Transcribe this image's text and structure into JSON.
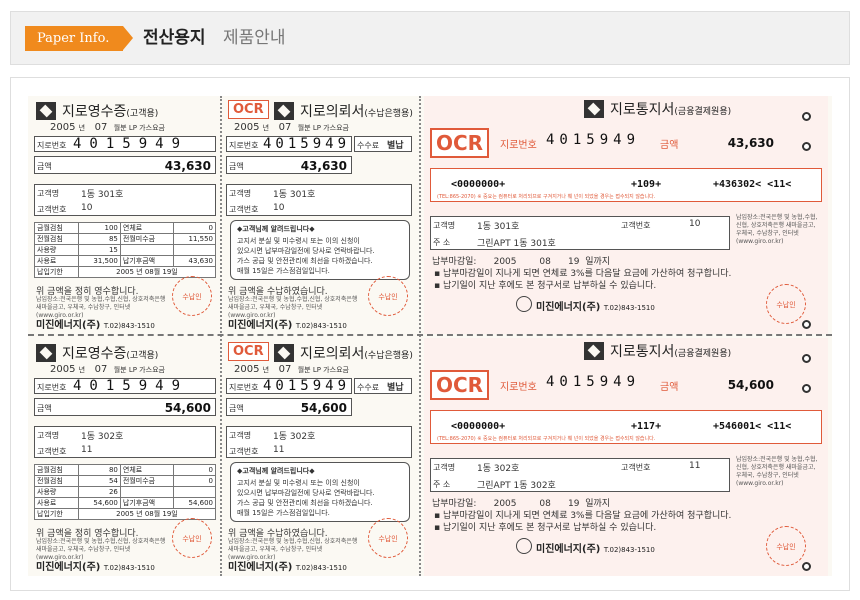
{
  "header": {
    "badge": "Paper Info.",
    "title_main": "전산용지",
    "title_sub": "제품안내"
  },
  "common": {
    "receipt_title": "지로영수증",
    "receipt_sub": "(고객용)",
    "confirm_title": "지로의뢰서",
    "confirm_sub": "(수납은행용)",
    "notice_title": "지로통지서",
    "notice_sub": "(금융결제원용)",
    "ocr": "OCR",
    "year": "2005",
    "year_unit": "년",
    "month": "07",
    "period_text": "월분 LP 가스요금",
    "giro_label": "지로번호",
    "giro_number": "4015949",
    "amount_label": "금액",
    "customer_label": "고객명",
    "cust_no_label": "고객번호",
    "fee_label": "수수료",
    "separate": "별납",
    "stamp": "수납인",
    "company": "미진에너지(주)",
    "phone": "T.02)843-1510",
    "address_label": "주 소",
    "due_label": "납부마감일:",
    "due_year": "2005",
    "due_month": "08",
    "due_day": "19",
    "due_suffix": "일까지",
    "notice_line1": "납부마감일이 지나게 되면 연체료 3%를 다음달 요금에 가산하여 청구합니다.",
    "notice_line2": "납기일이 지난 후에도 본 청구서로 납부하실 수 있습니다.",
    "receipt_confirm": "위 금액을 정히 영수합니다.",
    "confirm_paid": "위 금액을 수납하였습니다.",
    "guide_title": "◆고객님께 알려드립니다◆",
    "guide_lines": [
      "고지서 분실 및 미수령시 또는 이의 신청이",
      "있으시면 납부마감일전에 당사로 연락바랍니다.",
      "가스 공급 및 안전관리에 최선을 다하겠습니다.",
      "매월 15일은 가스점검일입니다."
    ],
    "banks_note": "납입장소:전국은행 및 농협,수협,신협, 상호저축은행 새마을금고, 우체국, 수납창구, 인터넷 (www.giro.or.kr)",
    "tbl_labels": [
      "금월검침",
      "전월검침",
      "사용량",
      "사용료",
      "납입기한"
    ],
    "tbl_right": [
      "연체료",
      "전월미수금",
      "납기후금액"
    ],
    "fine_print": "(TEL:865-2070) ※ 중요는 컴퓨터로 처리되므로 구겨지거나 훼 넌이 되었을 경우는 접수되지 않습니다."
  },
  "forms": [
    {
      "amount": "43,630",
      "customer": "1동 301호",
      "cust_no": "10",
      "address": "그린APT 1동  301호",
      "code_a": "<0000000+",
      "code_b": "+109+",
      "code_c": "+436302< <11<",
      "meter_now": "100",
      "meter_prev": "85",
      "usage": "15",
      "fee": "31,500",
      "late_fee": "0",
      "prev_unpaid": "11,550",
      "after_due": "43,630",
      "deadline": "2005 년 08월 19일"
    },
    {
      "amount": "54,600",
      "customer": "1동 302호",
      "cust_no": "11",
      "address": "그린APT 1동  302호",
      "code_a": "<0000000+",
      "code_b": "+117+",
      "code_c": "+546001< <11<",
      "meter_now": "80",
      "meter_prev": "54",
      "usage": "26",
      "fee": "54,600",
      "late_fee": "0",
      "prev_unpaid": "0",
      "after_due": "54,600",
      "deadline": "2005 년 08월 19일"
    }
  ]
}
